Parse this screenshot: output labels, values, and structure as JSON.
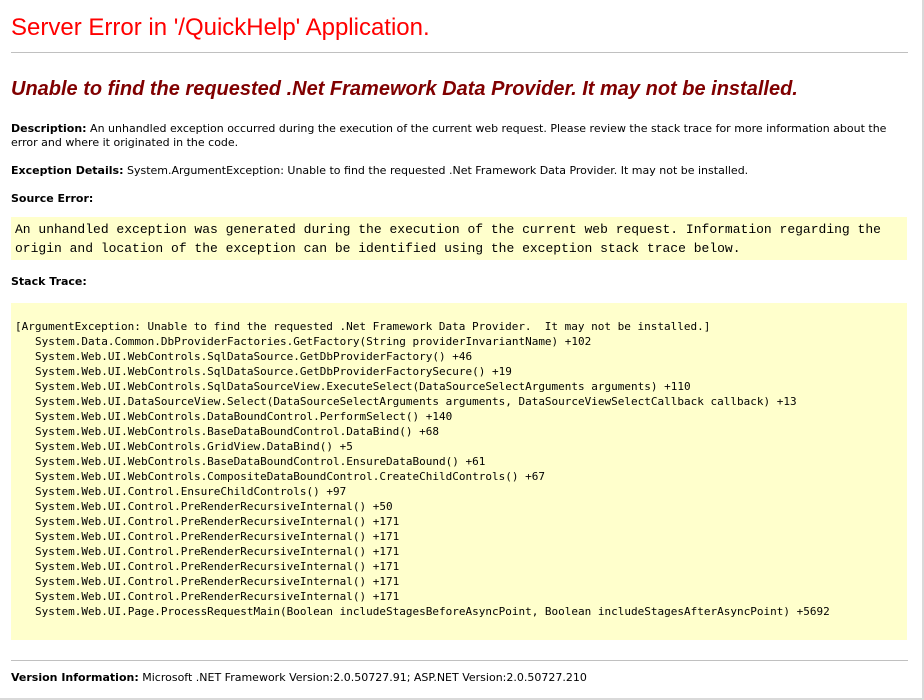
{
  "page": {
    "title": "Server Error in '/QuickHelp' Application.",
    "subtitle": "Unable to find the requested .Net Framework Data Provider.  It may not be installed."
  },
  "description": {
    "label": "Description:",
    "text": " An unhandled exception occurred during the execution of the current web request. Please review the stack trace for more information about the error and where it originated in the code."
  },
  "exception_details": {
    "label": "Exception Details:",
    "text": " System.ArgumentException: Unable to find the requested .Net Framework Data Provider.  It may not be installed."
  },
  "source_error": {
    "label": "Source Error:",
    "text": "An unhandled exception was generated during the execution of the current web request. Information regarding the origin and location of the exception can be identified using the exception stack trace below."
  },
  "stack_trace": {
    "label": "Stack Trace:",
    "header": "[ArgumentException: Unable to find the requested .Net Framework Data Provider.  It may not be installed.]",
    "frames": [
      "System.Data.Common.DbProviderFactories.GetFactory(String providerInvariantName) +102",
      "System.Web.UI.WebControls.SqlDataSource.GetDbProviderFactory() +46",
      "System.Web.UI.WebControls.SqlDataSource.GetDbProviderFactorySecure() +19",
      "System.Web.UI.WebControls.SqlDataSourceView.ExecuteSelect(DataSourceSelectArguments arguments) +110",
      "System.Web.UI.DataSourceView.Select(DataSourceSelectArguments arguments, DataSourceViewSelectCallback callback) +13",
      "System.Web.UI.WebControls.DataBoundControl.PerformSelect() +140",
      "System.Web.UI.WebControls.BaseDataBoundControl.DataBind() +68",
      "System.Web.UI.WebControls.GridView.DataBind() +5",
      "System.Web.UI.WebControls.BaseDataBoundControl.EnsureDataBound() +61",
      "System.Web.UI.WebControls.CompositeDataBoundControl.CreateChildControls() +67",
      "System.Web.UI.Control.EnsureChildControls() +97",
      "System.Web.UI.Control.PreRenderRecursiveInternal() +50",
      "System.Web.UI.Control.PreRenderRecursiveInternal() +171",
      "System.Web.UI.Control.PreRenderRecursiveInternal() +171",
      "System.Web.UI.Control.PreRenderRecursiveInternal() +171",
      "System.Web.UI.Control.PreRenderRecursiveInternal() +171",
      "System.Web.UI.Control.PreRenderRecursiveInternal() +171",
      "System.Web.UI.Control.PreRenderRecursiveInternal() +171",
      "System.Web.UI.Page.ProcessRequestMain(Boolean includeStagesBeforeAsyncPoint, Boolean includeStagesAfterAsyncPoint) +5692"
    ]
  },
  "version_information": {
    "label": "Version Information:",
    "text": " Microsoft .NET Framework Version:2.0.50727.91; ASP.NET Version:2.0.50727.210"
  },
  "colors": {
    "title": "#ff0000",
    "subtitle": "#800000",
    "code_background": "#ffffcc",
    "rule": "#c0c0c0"
  }
}
